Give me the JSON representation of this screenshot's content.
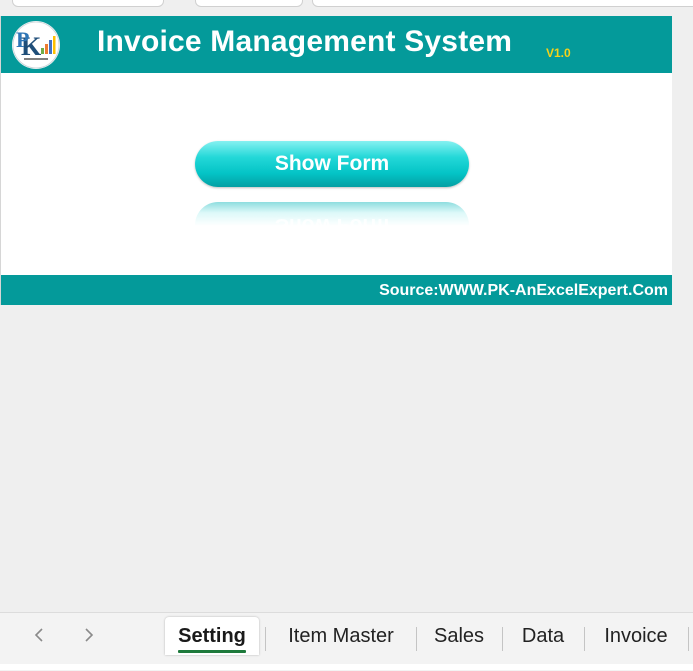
{
  "app": {
    "title": "Invoice Management System",
    "version": "V1.0"
  },
  "form_button": {
    "label": "Show Form",
    "reflection_text": "Show Form"
  },
  "footer": {
    "source": "Source:WWW.PK-AnExcelExpert.Com"
  },
  "logo": {
    "icon": "pk-logo-icon"
  },
  "colors": {
    "header": "#049a9a",
    "version": "#f5d21a",
    "button": "#04c4c6",
    "active_tab_underline": "#1e7a3c"
  },
  "sheet_tabs": {
    "prev_icon": "chevron-left-icon",
    "next_icon": "chevron-right-icon",
    "items": [
      {
        "label": "Setting",
        "active": true
      },
      {
        "label": "Item Master",
        "active": false
      },
      {
        "label": "Sales",
        "active": false
      },
      {
        "label": "Data",
        "active": false
      },
      {
        "label": "Invoice",
        "active": false
      }
    ]
  }
}
